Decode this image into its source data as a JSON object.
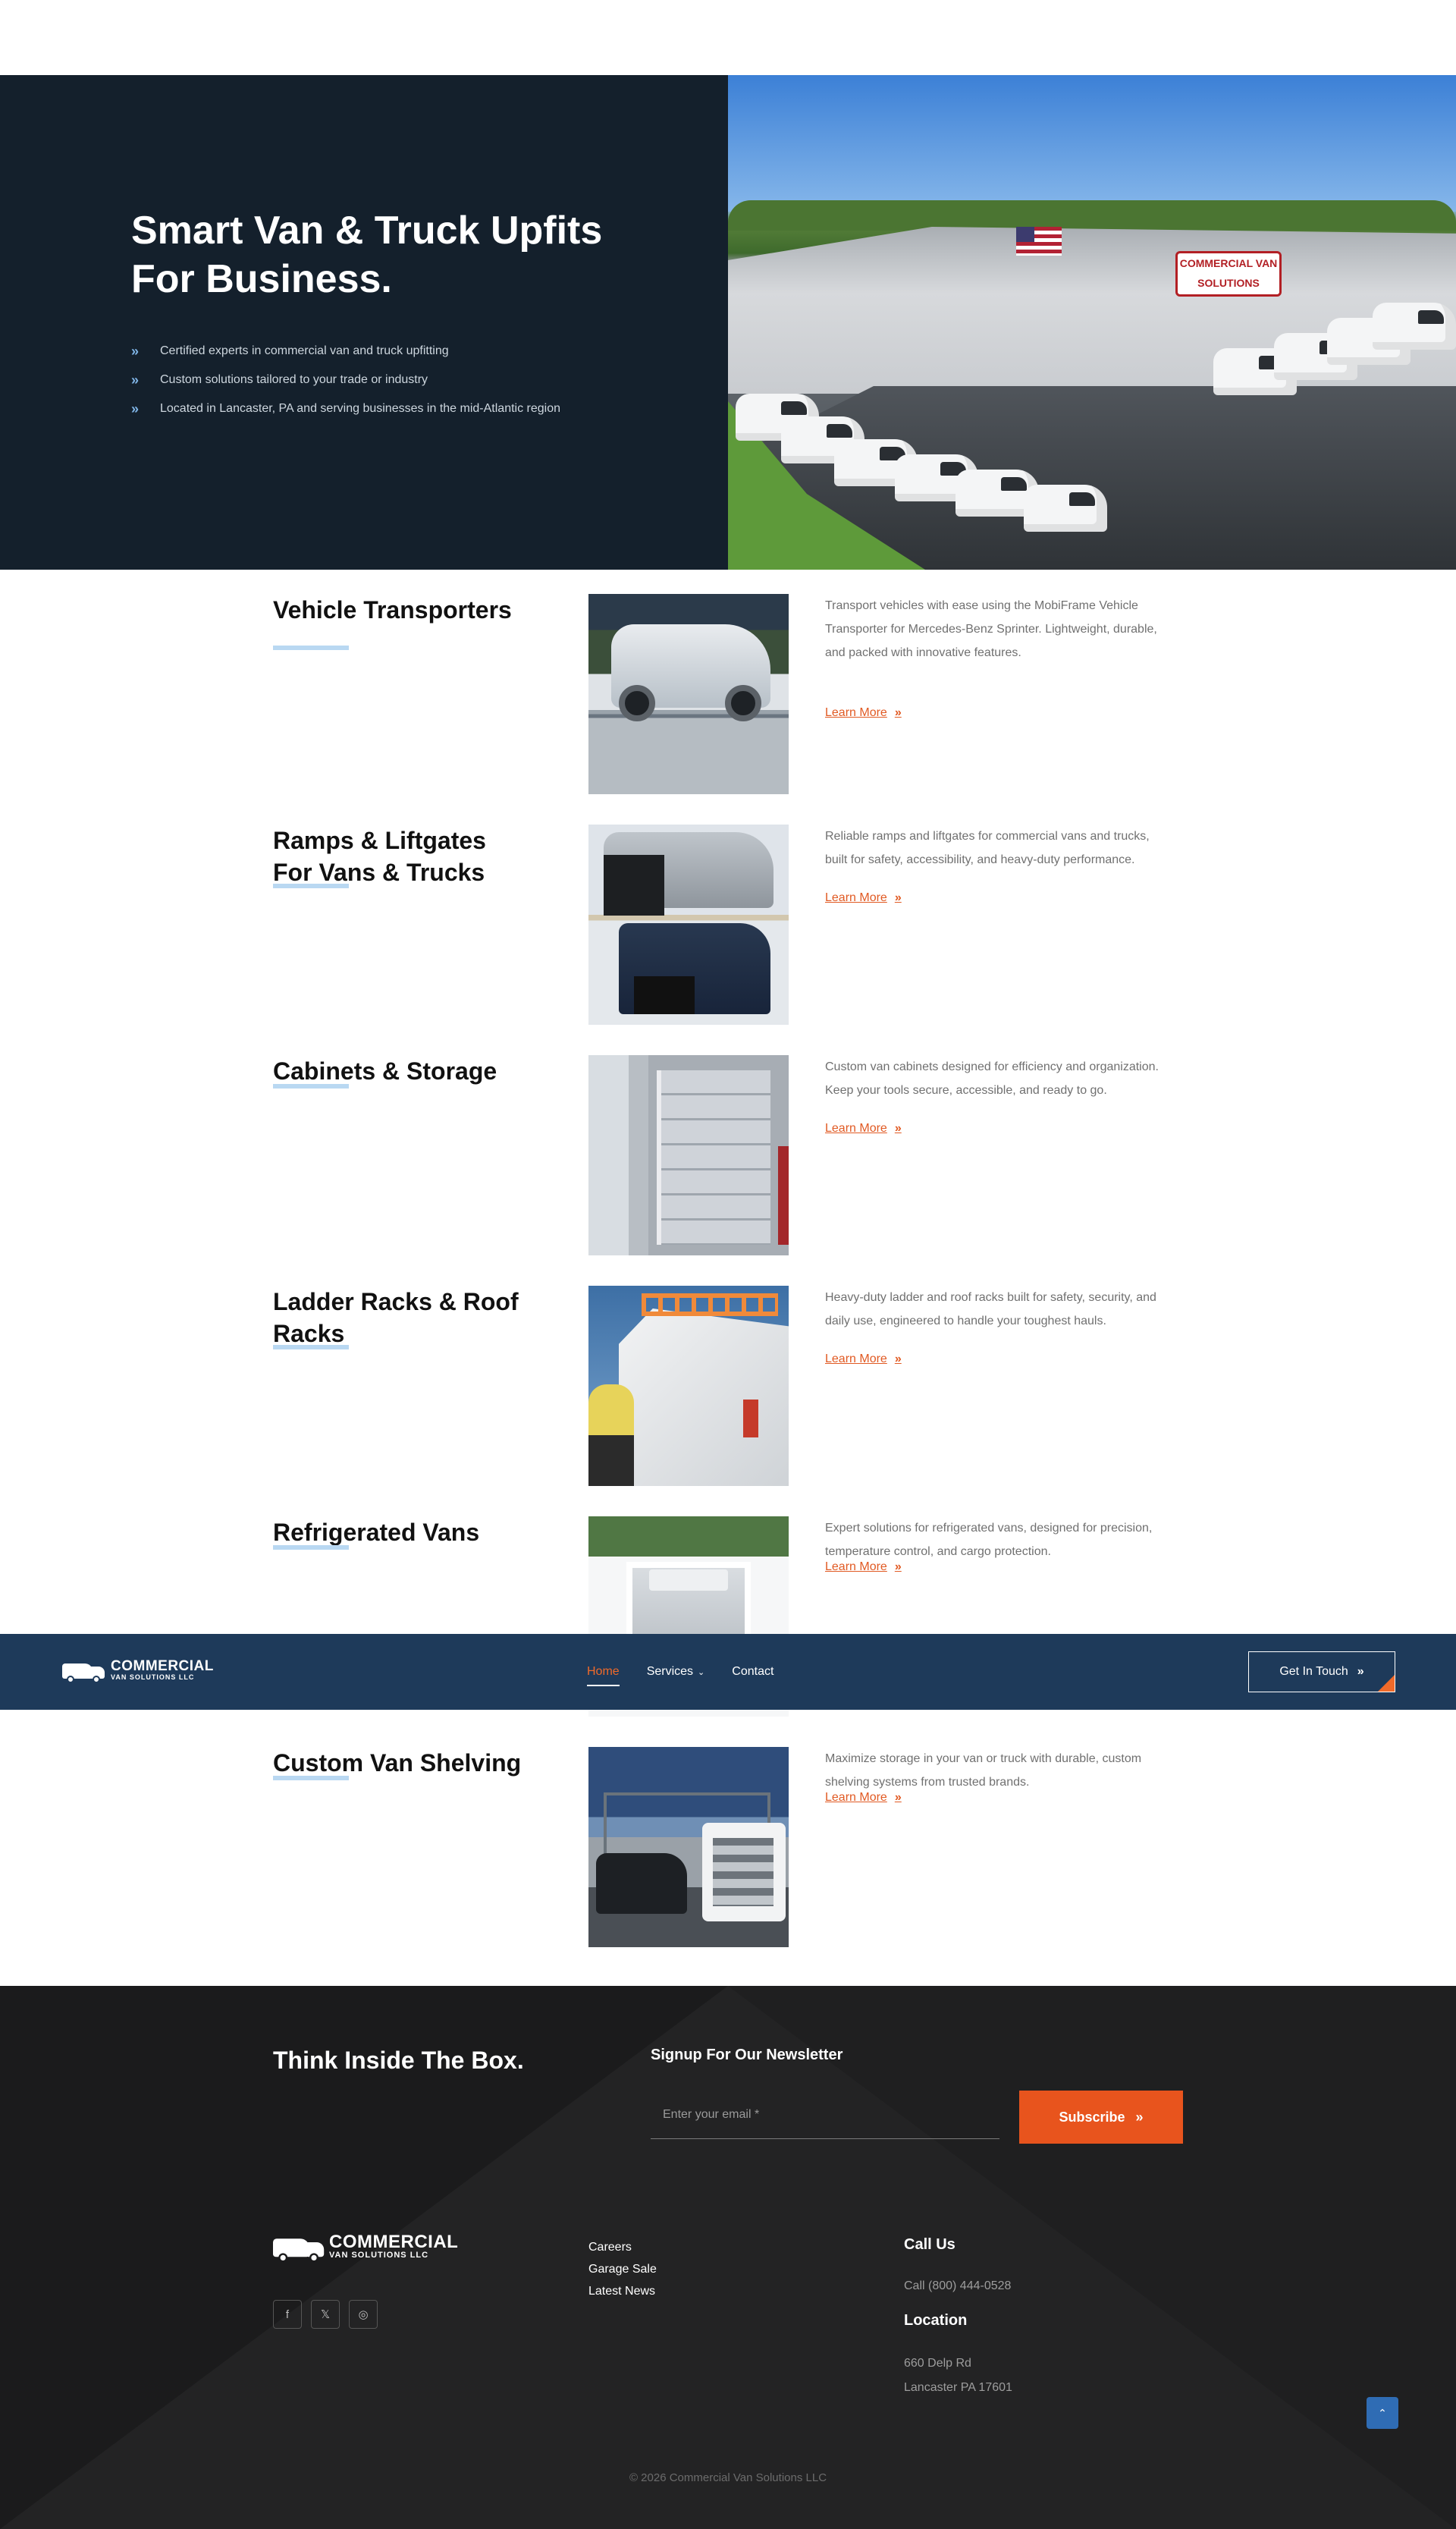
{
  "hero": {
    "title": "Smart Van & Truck Upfits For Business.",
    "bullets": [
      "Certified experts in commercial van and truck upfitting",
      "Custom solutions tailored to your trade or industry",
      "Located in Lancaster, PA and serving businesses in the mid-Atlantic region"
    ],
    "sign_text": "COMMERCIAL VAN SOLUTIONS"
  },
  "services": [
    {
      "title": "Vehicle Transporters",
      "description": "Transport vehicles with ease using the MobiFrame Vehicle Transporter for Mercedes-Benz Sprinter. Lightweight, durable, and packed with innovative features.",
      "link": "Learn More"
    },
    {
      "title": "Ramps & Liftgates For Vans & Trucks",
      "description": "Reliable ramps and liftgates for commercial vans and trucks, built for safety, accessibility, and heavy-duty performance.",
      "link": "Learn More"
    },
    {
      "title": "Cabinets & Storage",
      "description": "Custom van cabinets designed for efficiency and organization. Keep your tools secure, accessible, and ready to go.",
      "link": "Learn More"
    },
    {
      "title": "Ladder Racks & Roof Racks",
      "description": "Heavy-duty ladder and roof racks built for safety, security, and daily use, engineered to handle your toughest hauls.",
      "link": "Learn More"
    },
    {
      "title": "Refrigerated Vans",
      "description": "Expert solutions for refrigerated vans, designed for precision, temperature control, and cargo protection.",
      "link": "Learn More"
    },
    {
      "title": "Custom Van Shelving",
      "description": "Maximize storage in your van or truck with durable, custom shelving systems from trusted brands.",
      "link": "Learn More"
    }
  ],
  "nav": {
    "logo_line1": "COMMERCIAL",
    "logo_line2": "VAN SOLUTIONS LLC",
    "items": [
      "Home",
      "Services",
      "Contact"
    ],
    "cta": "Get In Touch"
  },
  "footer": {
    "tagline": "Think Inside The Box.",
    "newsletter_title": "Signup For Our Newsletter",
    "email_placeholder": "Enter your email *",
    "subscribe": "Subscribe",
    "links": [
      "Careers",
      "Garage Sale",
      "Latest News"
    ],
    "call_heading": "Call Us",
    "phone": "Call (800) 444-0528",
    "location_heading": "Location",
    "address_line1": "660 Delp Rd",
    "address_line2": "Lancaster PA 17601",
    "copyright": "© 2026 Commercial Van Solutions LLC"
  },
  "icons": {
    "bullet": "chevron-double-right-icon",
    "social": [
      "facebook-icon",
      "x-icon",
      "instagram-icon"
    ],
    "back_to_top": "chevron-up-icon"
  },
  "colors": {
    "hero_bg": "#14202c",
    "nav_bg": "#1e3a5a",
    "accent": "#e8541d",
    "underline": "#b9d8f2",
    "footer_bg": "#1b1b1c",
    "back_to_top": "#2f6cb4"
  }
}
